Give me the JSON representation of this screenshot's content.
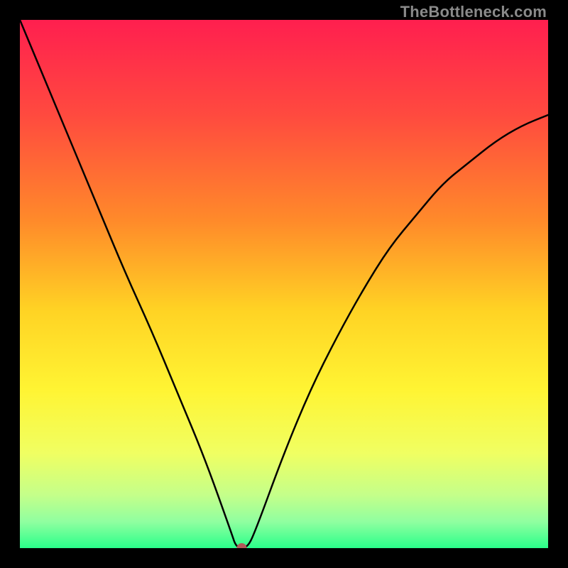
{
  "watermark": "TheBottleneck.com",
  "chart_data": {
    "type": "line",
    "title": "",
    "xlabel": "",
    "ylabel": "",
    "xlim": [
      0,
      100
    ],
    "ylim": [
      0,
      100
    ],
    "x": [
      0,
      5,
      10,
      15,
      20,
      25,
      30,
      35,
      40,
      41,
      43,
      44.5,
      50,
      55,
      60,
      65,
      70,
      75,
      80,
      85,
      90,
      95,
      100
    ],
    "values": [
      100,
      88,
      76,
      64,
      52,
      41,
      29,
      17,
      3,
      0,
      0,
      3,
      18,
      30,
      40,
      49,
      57,
      63,
      69,
      73,
      77,
      80,
      82
    ],
    "marker": {
      "x": 42,
      "y": 0,
      "color": "#b25a5a",
      "radius_px": 7
    },
    "gradient_stops": [
      {
        "offset": 0.0,
        "color": "#ff1f4f"
      },
      {
        "offset": 0.18,
        "color": "#ff4a3f"
      },
      {
        "offset": 0.38,
        "color": "#ff8a2a"
      },
      {
        "offset": 0.55,
        "color": "#ffd324"
      },
      {
        "offset": 0.7,
        "color": "#fff433"
      },
      {
        "offset": 0.82,
        "color": "#f0ff62"
      },
      {
        "offset": 0.9,
        "color": "#c4ff8a"
      },
      {
        "offset": 0.95,
        "color": "#90ffa0"
      },
      {
        "offset": 1.0,
        "color": "#2aff8a"
      }
    ]
  }
}
